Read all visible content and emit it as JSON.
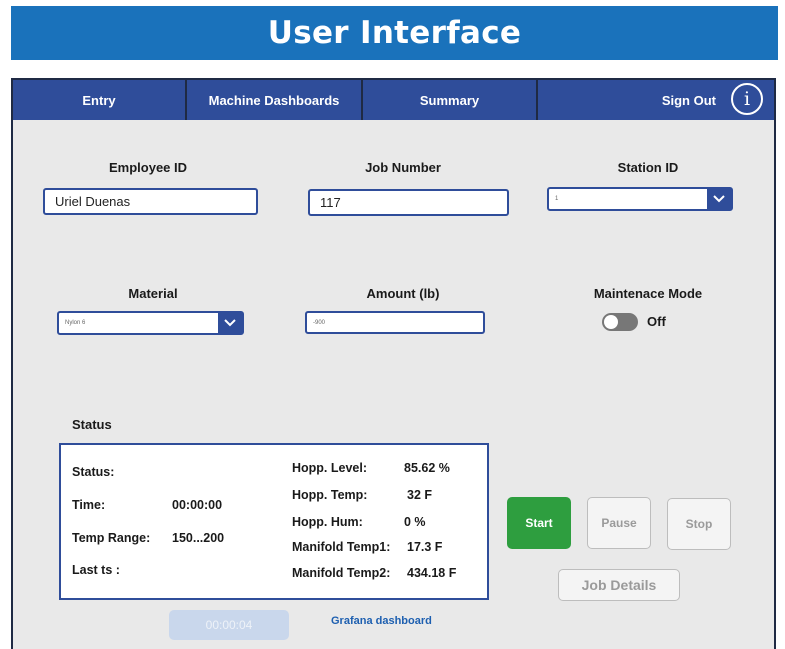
{
  "banner": {
    "title": "User Interface"
  },
  "nav": {
    "items": [
      {
        "label": "Entry"
      },
      {
        "label": "Machine Dashboards"
      },
      {
        "label": "Summary"
      },
      {
        "label": "Sign Out"
      }
    ],
    "info_icon": "info-icon"
  },
  "form": {
    "employee_id": {
      "label": "Employee ID",
      "value": "Uriel Duenas"
    },
    "job_number": {
      "label": "Job Number",
      "value": "117"
    },
    "station_id": {
      "label": "Station ID",
      "value": "1"
    },
    "material": {
      "label": "Material",
      "value": "Nylon 6"
    },
    "amount": {
      "label": "Amount (lb)",
      "value": "-900"
    },
    "maintenance": {
      "label": "Maintenace Mode",
      "state": "Off"
    }
  },
  "status": {
    "section_label": "Status",
    "status_label": "Status:",
    "time_label": "Time:",
    "time_value": "00:00:00",
    "temp_range_label": "Temp Range:",
    "temp_range_value": "150...200",
    "last_ts_label": "Last ts  :",
    "hopp_level_label": "Hopp. Level:",
    "hopp_level_value": "85.62 %",
    "hopp_temp_label": "Hopp. Temp:",
    "hopp_temp_value": "32 F",
    "hopp_hum_label": "Hopp. Hum:",
    "hopp_hum_value": "0 %",
    "manifold1_label": "Manifold Temp1:",
    "manifold1_value": "17.3 F",
    "manifold2_label": "Manifold Temp2:",
    "manifold2_value": "434.18 F"
  },
  "controls": {
    "start": "Start",
    "pause": "Pause",
    "stop": "Stop",
    "job_details": "Job Details",
    "timer": "00:00:04",
    "grafana_link": "Grafana dashboard"
  },
  "colors": {
    "banner": "#1a72bb",
    "nav": "#2f4d9a",
    "start": "#2e9e3f",
    "background": "#e9e9e9"
  }
}
